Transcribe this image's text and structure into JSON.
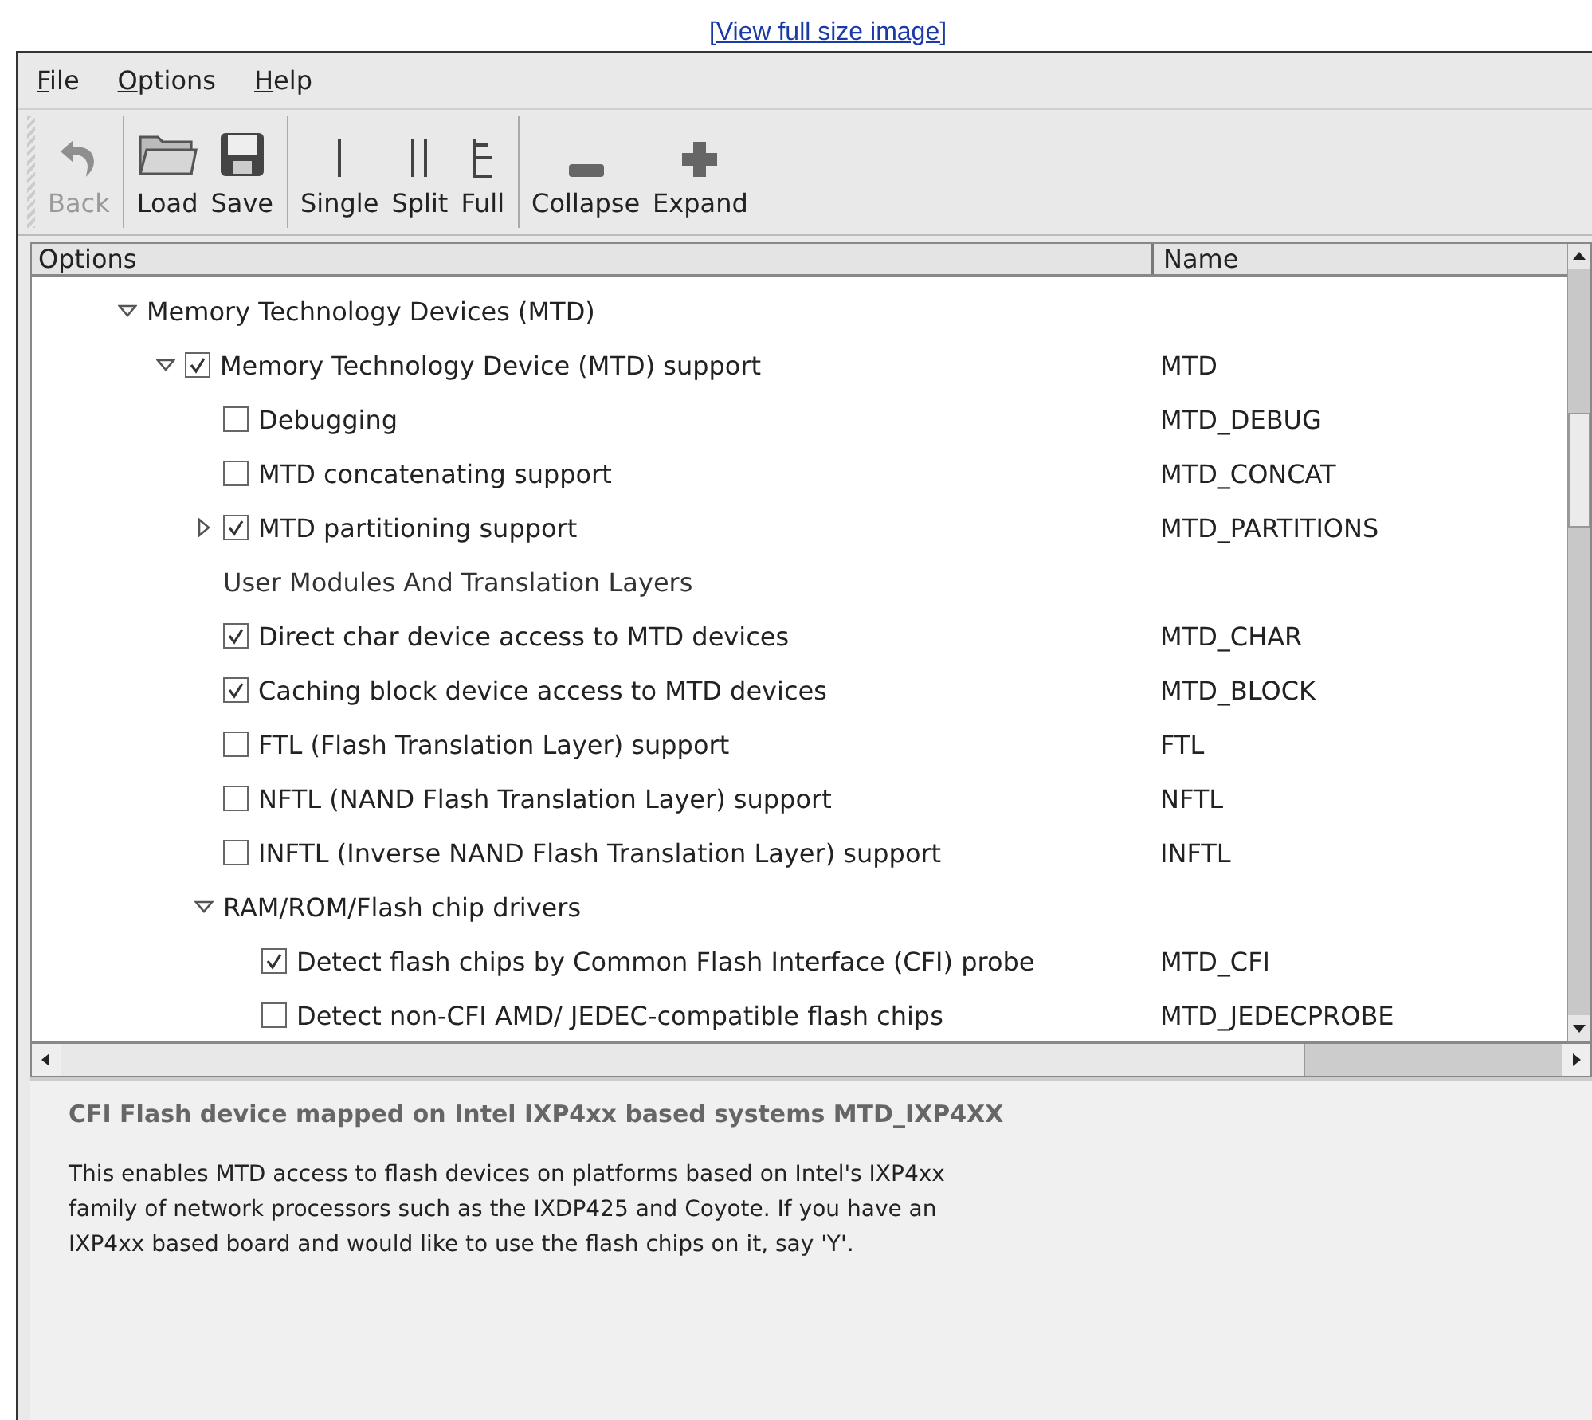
{
  "link": "[View full size image]",
  "menu": [
    "File",
    "Options",
    "Help"
  ],
  "toolbar": [
    [
      {
        "label": "Back",
        "disabled": true
      }
    ],
    [
      {
        "label": "Load",
        "disabled": false
      },
      {
        "label": "Save",
        "disabled": false
      }
    ],
    [
      {
        "label": "Single",
        "disabled": false
      },
      {
        "label": "Split",
        "disabled": false
      },
      {
        "label": "Full",
        "disabled": false
      }
    ],
    [
      {
        "label": "Collapse",
        "disabled": false
      },
      {
        "label": "Expand",
        "disabled": false
      }
    ]
  ],
  "table": {
    "columns": [
      "Options",
      "Name"
    ],
    "rows": [
      {
        "kind": "group",
        "label": "Memory Technology Devices (MTD)",
        "expanded": true,
        "children": [
          {
            "kind": "option",
            "label": "Memory Technology Device (MTD) support",
            "name": "MTD",
            "checked": true,
            "expanded": true,
            "children": [
              {
                "kind": "option",
                "label": "Debugging",
                "name": "MTD_DEBUG",
                "checked": false
              },
              {
                "kind": "option",
                "label": "MTD concatenating support",
                "name": "MTD_CONCAT",
                "checked": false
              },
              {
                "kind": "option",
                "label": "MTD partitioning support",
                "name": "MTD_PARTITIONS",
                "checked": true,
                "expanded": false
              },
              {
                "kind": "label",
                "label": "User Modules And Translation Layers"
              },
              {
                "kind": "option",
                "label": "Direct char device access to MTD devices",
                "name": "MTD_CHAR",
                "checked": true
              },
              {
                "kind": "option",
                "label": "Caching block device access to MTD devices",
                "name": "MTD_BLOCK",
                "checked": true
              },
              {
                "kind": "option",
                "label": "FTL (Flash Translation Layer) support",
                "name": "FTL",
                "checked": false
              },
              {
                "kind": "option",
                "label": "NFTL (NAND Flash Translation Layer) support",
                "name": "NFTL",
                "checked": false
              },
              {
                "kind": "option",
                "label": "INFTL (Inverse NAND Flash Translation Layer) support",
                "name": "INFTL",
                "checked": false
              },
              {
                "kind": "group",
                "label": "RAM/ROM/Flash chip drivers",
                "expanded": true,
                "children": [
                  {
                    "kind": "option",
                    "label": "Detect flash chips by Common Flash Interface (CFI) probe",
                    "name": "MTD_CFI",
                    "checked": true
                  },
                  {
                    "kind": "option",
                    "label": "Detect non-CFI AMD/ JEDEC-compatible flash chips",
                    "name": "MTD_JEDECPROBE",
                    "checked": false
                  }
                ]
              }
            ]
          }
        ]
      }
    ]
  },
  "description": {
    "title": "CFI Flash device mapped on Intel IXP4xx based systems MTD_IXP4XX",
    "text": "This enables MTD access to flash devices on platforms based on Intel's IXP4xx family of network processors such as the IXDP425 and Coyote. If you have an IXP4xx based board and would like to use the flash chips on it, say 'Y'."
  }
}
